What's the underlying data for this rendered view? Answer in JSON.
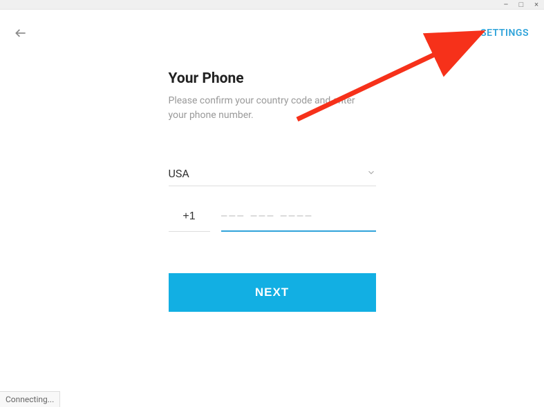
{
  "window_controls": {
    "minimize": "–",
    "maximize": "□",
    "close": "×"
  },
  "header": {
    "settings_label": "SETTINGS"
  },
  "form": {
    "title": "Your Phone",
    "instruction": "Please confirm your country code and enter your phone number.",
    "country_selected": "USA",
    "code_value": "+1",
    "phone_placeholder": "––– ––– ––––",
    "next_label": "NEXT"
  },
  "status": {
    "connecting": "Connecting..."
  },
  "colors": {
    "accent": "#12afe3",
    "link": "#2fa3da",
    "annotation": "#f6311a"
  }
}
